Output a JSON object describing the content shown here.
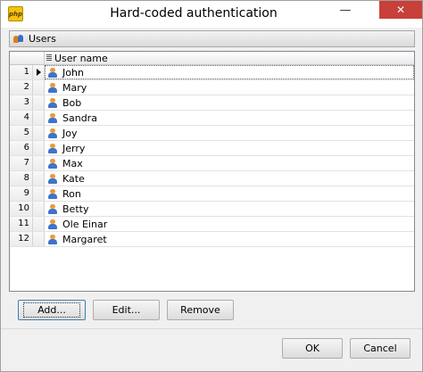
{
  "window": {
    "title": "Hard-coded authentication",
    "app_icon_text": "php",
    "minimize_glyph": "—",
    "close_glyph": "✕"
  },
  "group": {
    "title": "Users",
    "icon": "users-icon"
  },
  "grid": {
    "column_header": "User name",
    "current_row": 1,
    "rows": [
      {
        "num": "1",
        "name": "John"
      },
      {
        "num": "2",
        "name": "Mary"
      },
      {
        "num": "3",
        "name": "Bob"
      },
      {
        "num": "4",
        "name": "Sandra"
      },
      {
        "num": "5",
        "name": "Joy"
      },
      {
        "num": "6",
        "name": "Jerry"
      },
      {
        "num": "7",
        "name": "Max"
      },
      {
        "num": "8",
        "name": "Kate"
      },
      {
        "num": "9",
        "name": "Ron"
      },
      {
        "num": "10",
        "name": "Betty"
      },
      {
        "num": "11",
        "name": "Ole Einar"
      },
      {
        "num": "12",
        "name": "Margaret"
      }
    ]
  },
  "actions": {
    "add": "Add...",
    "edit": "Edit...",
    "remove": "Remove"
  },
  "dialog": {
    "ok": "OK",
    "cancel": "Cancel"
  }
}
